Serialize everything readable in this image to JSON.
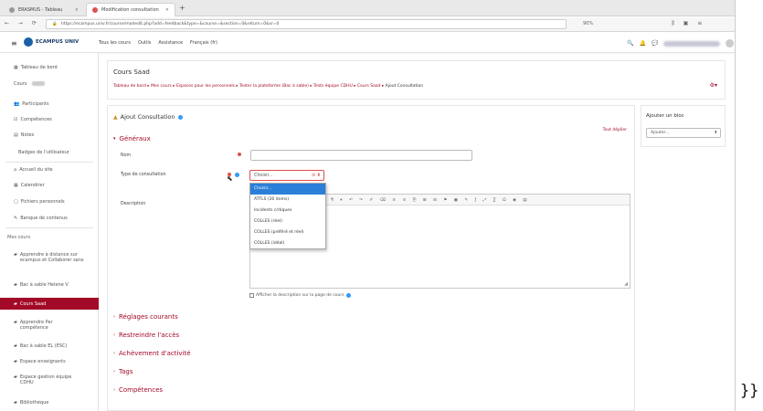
{
  "browser": {
    "tabs": [
      {
        "label": "ERASMUS - Tableau",
        "active": false
      },
      {
        "label": "Modification consultation",
        "active": true
      }
    ],
    "url": "https://ecampus.univ.fr/course/modedit.php?add=feedback&type=&course=&section=0&return=0&sr=0",
    "zoom": "90%"
  },
  "navbar": {
    "brand": "ECAMPUS UNIV",
    "menu": [
      "Tous les cours",
      "Outils",
      "Assistance",
      "Français (fr)"
    ]
  },
  "sidebar": {
    "items": [
      {
        "label": "Tableau de bord",
        "icon": "dashboard-icon"
      },
      {
        "label": "Cours"
      },
      {
        "label": "Participants",
        "icon": "users-icon"
      },
      {
        "label": "Compétences",
        "icon": "checklist-icon"
      },
      {
        "label": "Notes",
        "icon": "grades-icon"
      },
      {
        "label": "Badges de l'utilisateur"
      },
      {
        "label": "Accueil du site",
        "icon": "home-icon"
      },
      {
        "label": "Calendrier",
        "icon": "calendar-icon"
      },
      {
        "label": "Fichiers personnels",
        "icon": "file-icon"
      },
      {
        "label": "Banque de contenus",
        "icon": "pencil-icon"
      }
    ],
    "section_label": "Mes cours",
    "courses": [
      {
        "label": "Apprendre à distance sur ecampus et Collaborer sans",
        "active": false
      },
      {
        "label": "Bac à sable Helene V",
        "active": false
      },
      {
        "label": "Cours Saad",
        "active": true
      },
      {
        "label": "Apprendre Par compétence",
        "active": false
      },
      {
        "label": "Bac à sable EL (ESC)",
        "active": false
      },
      {
        "label": "Espace enseignants",
        "active": false
      },
      {
        "label": "Espace gestion équipe CDHU",
        "active": false
      },
      {
        "label": "Bibliothèque",
        "active": false
      }
    ]
  },
  "header": {
    "course_title": "Cours Saad",
    "breadcrumb": [
      "Tableau de bord",
      "Mes cours",
      "Espaces pour les personnels",
      "Tester la plateforme (Bac à sable)",
      "Tests équipe CDHU",
      "Cours Saad"
    ],
    "breadcrumb_last": "Ajout Consultation"
  },
  "form": {
    "title": "Ajout Consultation",
    "expand_all": "Tout déplier",
    "general_section": "Généraux",
    "name_label": "Nom",
    "type_label": "Type de consultation",
    "description_label": "Description",
    "select_value": "Choisir...",
    "dropdown_options": [
      "Choisir...",
      "ATTLS (20 items)",
      "Incidents critiques",
      "COLLES (réel)",
      "COLLES (préféré et réel)",
      "COLLES (idéal)"
    ],
    "editor_toolbar": "¶ ▾  ↶ ↷  ✐ ⌫  ≡ ≡  ⎘  ⊞  ⊟  ⚑  ▣  ✎  ƒ  ⤢  ∑  Ω  ◉  ▤",
    "show_description_label": "Afficher la description sur la page de cours",
    "collapsed_sections": [
      "Réglages courants",
      "Restreindre l'accès",
      "Achèvement d'activité",
      "Tags",
      "Compétences"
    ]
  },
  "add_block": {
    "title": "Ajouter un bloc",
    "select_value": "Ajouter..."
  },
  "colors": {
    "accent": "#a30a27",
    "link": "#a30a27",
    "selection": "#2b7fd8"
  },
  "trailing_text": "}}"
}
